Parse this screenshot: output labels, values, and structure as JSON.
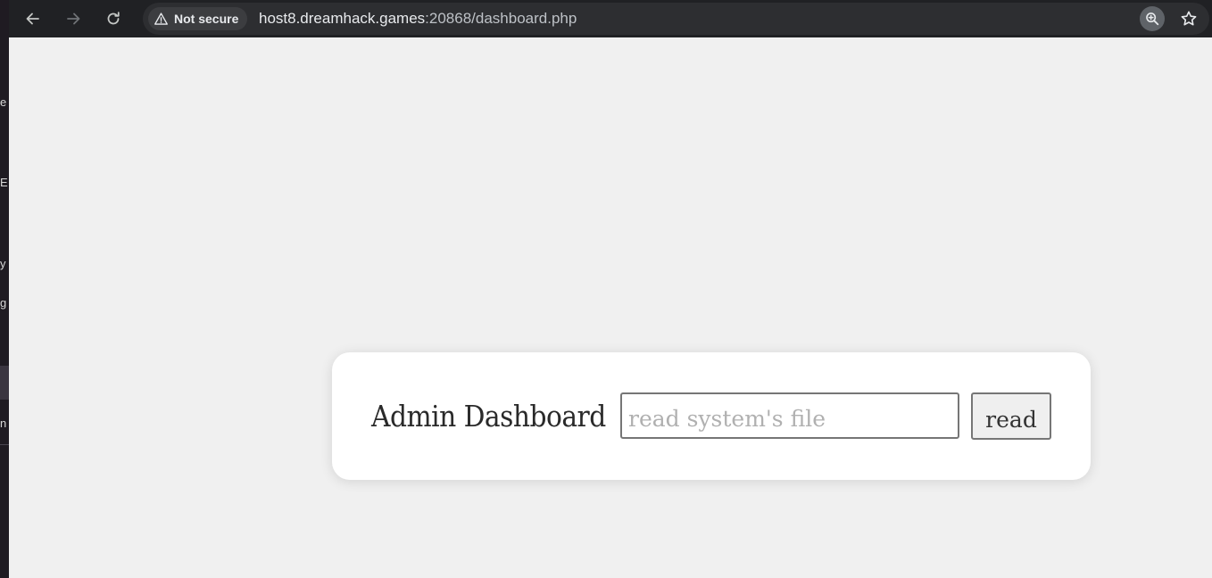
{
  "browser": {
    "security_chip": "Not secure",
    "url_host": "host8.dreamhack.games",
    "url_rest": ":20868/dashboard.php"
  },
  "left_fragments": [
    "e",
    "E",
    "y",
    "g",
    "n"
  ],
  "page": {
    "title": "Admin Dashboard",
    "file_input": {
      "placeholder": "read system's file",
      "value": ""
    },
    "read_button": "read"
  },
  "colors": {
    "page_background": "#f0f0f0",
    "card_background": "#ffffff",
    "toolbar_background": "#202124"
  },
  "icons": {
    "back": "arrow-left-icon",
    "forward": "arrow-right-icon",
    "reload": "reload-icon",
    "warning": "warning-triangle-icon",
    "zoom": "zoom-in-icon",
    "bookmark": "star-icon"
  }
}
